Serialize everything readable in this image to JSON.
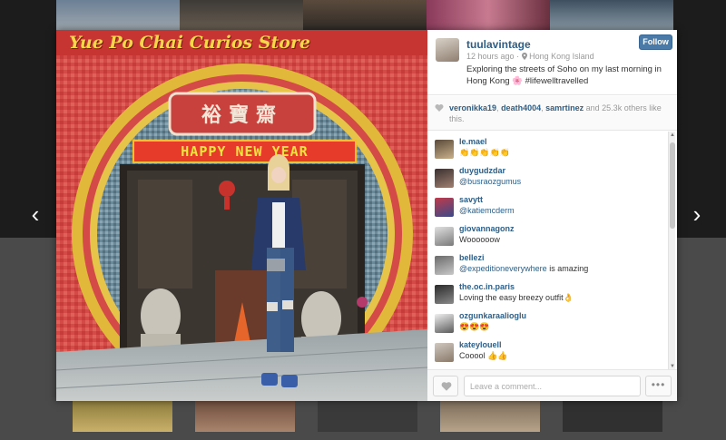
{
  "post": {
    "username": "tuulavintage",
    "time_ago": "12 hours ago",
    "location": "Hong Kong Island",
    "caption": "Exploring the streets of Soho on my last morning in Hong Kong 🌸 #lifewelltravelled",
    "follow_label": "Follow"
  },
  "photo": {
    "sign_text": "Yue Po Chai Curios Store",
    "banner_text": "HAPPY NEW YEAR",
    "plaque_text": "裕寶齋"
  },
  "likes": {
    "likers": [
      "veronikka19",
      "death4004",
      "samrtinez"
    ],
    "sep": ", ",
    "and_text": " and ",
    "count": "25.3k",
    "suffix": " others like this."
  },
  "comments": [
    {
      "user": "le.mael",
      "text": "👏👏👏👏👏",
      "mention": "",
      "after": ""
    },
    {
      "user": "duygudzdar",
      "text": "",
      "mention": "@busraozgumus",
      "after": ""
    },
    {
      "user": "savytt",
      "text": "",
      "mention": "@katiemcderm",
      "after": ""
    },
    {
      "user": "giovannagonz",
      "text": "Woooooow",
      "mention": "",
      "after": ""
    },
    {
      "user": "bellezi",
      "text": "",
      "mention": "@expeditioneverywhere",
      "after": " is amazing"
    },
    {
      "user": "the.oc.in.paris",
      "text": "Loving the easy breezy outfit👌",
      "mention": "",
      "after": ""
    },
    {
      "user": "ozgunkaraalioglu",
      "text": "😍😍😍",
      "mention": "",
      "after": ""
    },
    {
      "user": "kateylouell",
      "text": "Cooool 👍👍",
      "mention": "",
      "after": ""
    }
  ],
  "footer": {
    "comment_placeholder": "Leave a comment...",
    "more_label": "•••"
  },
  "nav": {
    "prev": "‹",
    "next": "›"
  },
  "icons": {
    "heart": "heart-icon",
    "location": "location-pin-icon",
    "prev": "chevron-left-icon",
    "next": "chevron-right-icon"
  },
  "colors": {
    "link": "#2e5e86",
    "follow_button": "#4a7ba8",
    "muted": "#999999"
  }
}
